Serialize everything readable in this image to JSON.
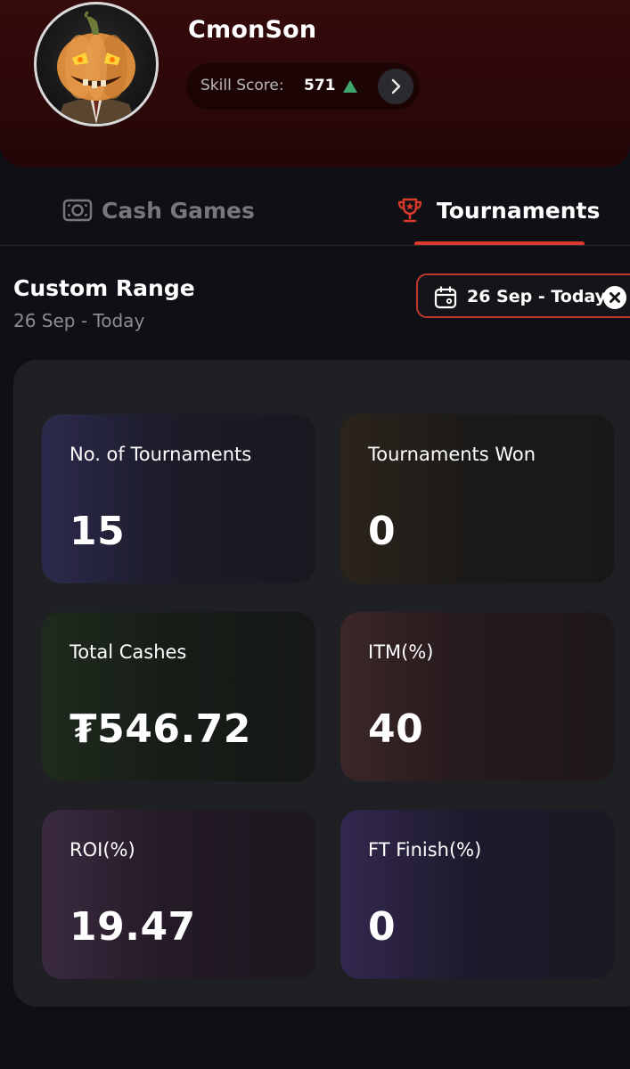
{
  "profile": {
    "username": "CmonSon",
    "skill_label": "Skill Score:",
    "skill_value": "571",
    "skill_trend": "up",
    "avatar_icon": "pumpkin-avatar"
  },
  "tabs": [
    {
      "label": "Cash Games",
      "icon": "cash-icon",
      "active": false
    },
    {
      "label": "Tournaments",
      "icon": "trophy-icon",
      "active": true
    }
  ],
  "range": {
    "title": "Custom Range",
    "subtitle": "26 Sep - Today",
    "chip_label": "26 Sep - Today",
    "chip_icon": "calendar-icon",
    "clear_icon": "close-circle-icon"
  },
  "stats": [
    {
      "label": "No. of Tournaments",
      "value": "15"
    },
    {
      "label": "Tournaments Won",
      "value": "0"
    },
    {
      "label": "Total Cashes",
      "value": "₮546.72"
    },
    {
      "label": "ITM(%)",
      "value": "40"
    },
    {
      "label": "ROI(%)",
      "value": "19.47"
    },
    {
      "label": "FT Finish(%)",
      "value": "0"
    }
  ],
  "colors": {
    "accent": "#d93a2b",
    "trend_up": "#3fa66b",
    "header_bg": "#2a0708",
    "page_bg": "#0e1015"
  }
}
